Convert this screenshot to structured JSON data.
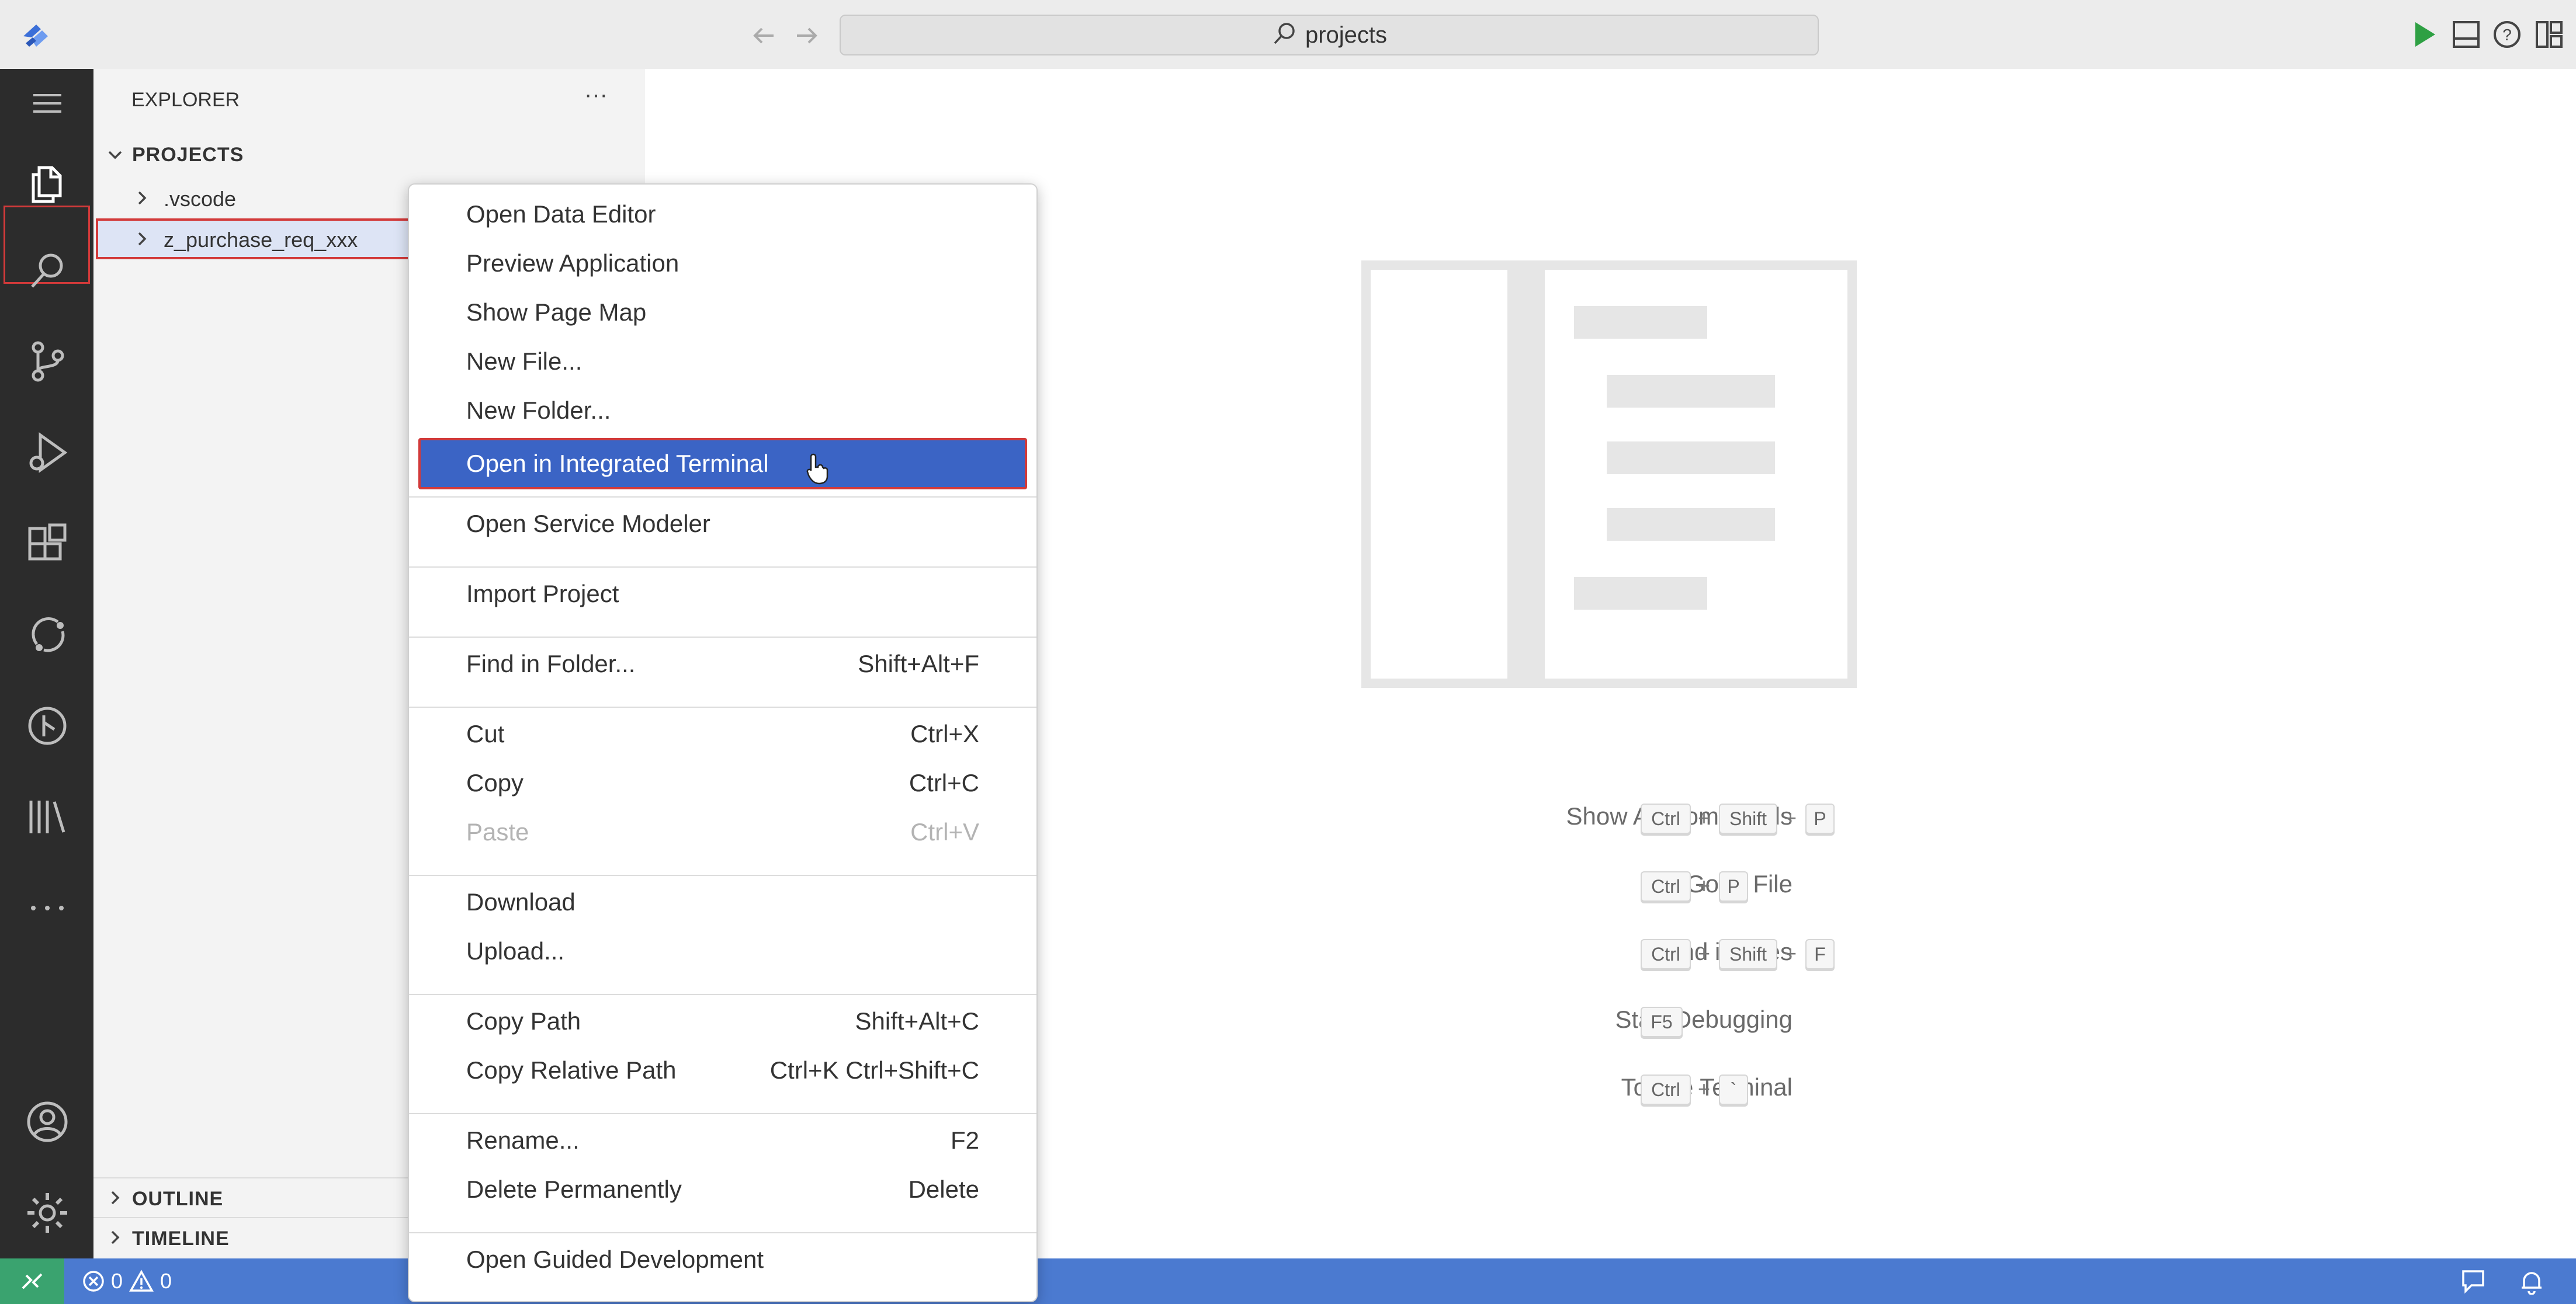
{
  "titlebar": {
    "search_text": "projects",
    "back_icon": "arrow-left-icon",
    "forward_icon": "arrow-right-icon",
    "run_icon": "play-icon",
    "panel_icon": "panel-layout-icon",
    "help_icon": "help-icon",
    "layout_icon": "customize-layout-icon"
  },
  "activitybar": {
    "items": [
      "menu-icon",
      "explorer-icon",
      "search-icon",
      "source-control-icon",
      "run-debug-icon",
      "extensions-icon",
      "cloud-icon",
      "git-graph-icon",
      "library-icon",
      "more-icon",
      "account-icon",
      "settings-icon"
    ]
  },
  "sidebar": {
    "title": "EXPLORER",
    "more_label": "···",
    "section": "PROJECTS",
    "items": [
      ".vscode",
      "z_purchase_req_xxx"
    ],
    "outline": "OUTLINE",
    "timeline": "TIMELINE"
  },
  "menu": {
    "items": [
      {
        "label": "Open Data Editor",
        "key": ""
      },
      {
        "label": "Preview Application",
        "key": ""
      },
      {
        "label": "Show Page Map",
        "key": ""
      },
      {
        "label": "New File...",
        "key": ""
      },
      {
        "label": "New Folder...",
        "key": ""
      },
      {
        "label": "Open in Integrated Terminal",
        "key": ""
      },
      {
        "label": "Open Service Modeler",
        "key": ""
      },
      {
        "label": "Import Project",
        "key": ""
      },
      {
        "label": "Find in Folder...",
        "key": "Shift+Alt+F"
      },
      {
        "label": "Cut",
        "key": "Ctrl+X"
      },
      {
        "label": "Copy",
        "key": "Ctrl+C"
      },
      {
        "label": "Paste",
        "key": "Ctrl+V"
      },
      {
        "label": "Download",
        "key": ""
      },
      {
        "label": "Upload...",
        "key": ""
      },
      {
        "label": "Copy Path",
        "key": "Shift+Alt+C"
      },
      {
        "label": "Copy Relative Path",
        "key": "Ctrl+K Ctrl+Shift+C"
      },
      {
        "label": "Rename...",
        "key": "F2"
      },
      {
        "label": "Delete Permanently",
        "key": "Delete"
      },
      {
        "label": "Open Guided Development",
        "key": ""
      }
    ]
  },
  "editor": {
    "shortcuts": [
      {
        "label": "Show All Commands",
        "keys": [
          "Ctrl",
          "Shift",
          "P"
        ]
      },
      {
        "label": "Go to File",
        "keys": [
          "Ctrl",
          "P"
        ]
      },
      {
        "label": "Find in Files",
        "keys": [
          "Ctrl",
          "Shift",
          "F"
        ]
      },
      {
        "label": "Start Debugging",
        "keys": [
          "F5"
        ]
      },
      {
        "label": "Toggle Terminal",
        "keys": [
          "Ctrl",
          "`"
        ]
      }
    ]
  },
  "statusbar": {
    "errors": "0",
    "warnings": "0"
  },
  "colors": {
    "accent": "#3b64c5",
    "statusbar": "#4b7ad0",
    "highlight_border": "#d23a3a",
    "run_green": "#2ea043"
  }
}
